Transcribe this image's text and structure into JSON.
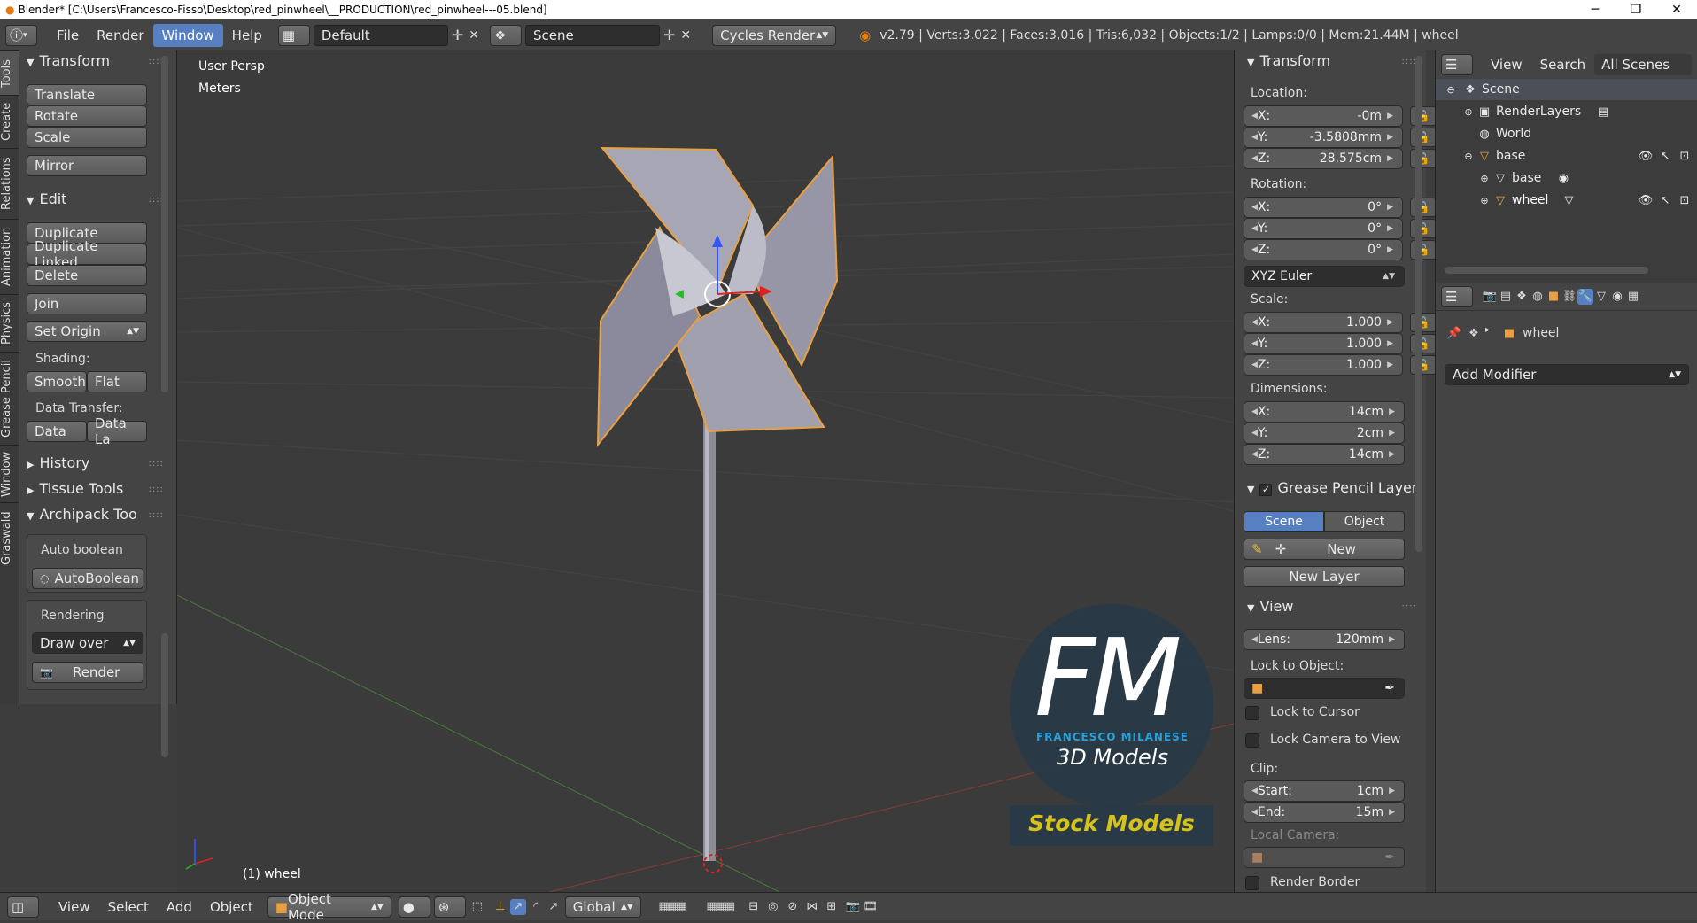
{
  "titlebar": {
    "title": "Blender* [C:\\Users\\Francesco-Fisso\\Desktop\\red_pinwheel\\__PRODUCTION\\red_pinwheel---05.blend]",
    "min": "─",
    "max": "❐",
    "close": "✕"
  },
  "menu": {
    "file": "File",
    "render": "Render",
    "window": "Window",
    "help": "Help"
  },
  "screen_layout": "Default",
  "scene_name": "Scene",
  "render_engine": "Cycles Render",
  "stats": "v2.79 | Verts:3,022 | Faces:3,016 | Tris:6,032 | Objects:1/2 | Lamps:0/0 | Mem:21.44M | wheel",
  "lefttabs": [
    "Tools",
    "Create",
    "Relations",
    "Animation",
    "Physics",
    "Grease Pencil",
    "Window",
    "Graswald"
  ],
  "toolshelf": {
    "transform_header": "Transform",
    "translate": "Translate",
    "rotate": "Rotate",
    "scale": "Scale",
    "mirror": "Mirror",
    "edit_header": "Edit",
    "duplicate": "Duplicate",
    "duplicate_linked": "Duplicate Linked",
    "delete": "Delete",
    "join": "Join",
    "set_origin": "Set Origin",
    "shading_label": "Shading:",
    "smooth": "Smooth",
    "flat": "Flat",
    "data_transfer_label": "Data Transfer:",
    "data": "Data",
    "data_la": "Data La",
    "history": "History",
    "tissue_tools": "Tissue Tools",
    "archipack": "Archipack Too",
    "auto_boolean_label": "Auto boolean",
    "autoboolean_btn": "AutoBoolean",
    "rendering_label": "Rendering",
    "draw_over": "Draw over",
    "render_btn": "Render"
  },
  "viewport": {
    "view_name": "User Persp",
    "units": "Meters",
    "object_label": "(1) wheel",
    "logo_big": "FM",
    "logo_sub": "FRANCESCO MILANESE",
    "logo_3d": "3D Models",
    "logo_stock": "Stock Models"
  },
  "npanel": {
    "transform_header": "Transform",
    "location_label": "Location:",
    "loc": [
      {
        "axis": "X:",
        "value": "-0m"
      },
      {
        "axis": "Y:",
        "value": "-3.5808mm"
      },
      {
        "axis": "Z:",
        "value": "28.575cm"
      }
    ],
    "rotation_label": "Rotation:",
    "rot": [
      {
        "axis": "X:",
        "value": "0°"
      },
      {
        "axis": "Y:",
        "value": "0°"
      },
      {
        "axis": "Z:",
        "value": "0°"
      }
    ],
    "rotation_mode": "XYZ Euler",
    "scale_label": "Scale:",
    "scl": [
      {
        "axis": "X:",
        "value": "1.000"
      },
      {
        "axis": "Y:",
        "value": "1.000"
      },
      {
        "axis": "Z:",
        "value": "1.000"
      }
    ],
    "dimensions_label": "Dimensions:",
    "dim": [
      {
        "axis": "X:",
        "value": "14cm"
      },
      {
        "axis": "Y:",
        "value": "2cm"
      },
      {
        "axis": "Z:",
        "value": "14cm"
      }
    ],
    "grease_header": "Grease Pencil Layer",
    "gp_scene": "Scene",
    "gp_object": "Object",
    "gp_new": "New",
    "gp_new_layer": "New Layer",
    "view_header": "View",
    "lens_label": "Lens:",
    "lens_value": "120mm",
    "lock_to_object": "Lock to Object:",
    "lock_to_cursor": "Lock to Cursor",
    "lock_camera": "Lock Camera to View",
    "clip_label": "Clip:",
    "clip_start_label": "Start:",
    "clip_start_value": "1cm",
    "clip_end_label": "End:",
    "clip_end_value": "15m",
    "local_camera": "Local Camera:",
    "render_border": "Render Border"
  },
  "outliner": {
    "view": "View",
    "search": "Search",
    "filter": "All Scenes",
    "items": [
      "Scene",
      "RenderLayers",
      "World",
      "base",
      "base",
      "wheel"
    ]
  },
  "properties": {
    "object_name": "wheel",
    "add_modifier": "Add Modifier"
  },
  "bottombar": {
    "view": "View",
    "select": "Select",
    "add": "Add",
    "object": "Object",
    "mode": "Object Mode",
    "orientation": "Global"
  },
  "colors": {
    "accent": "#5680c2",
    "selection": "#e8a043",
    "logo_blue": "#2aa0d8",
    "logo_yellow": "#d6c21a"
  }
}
